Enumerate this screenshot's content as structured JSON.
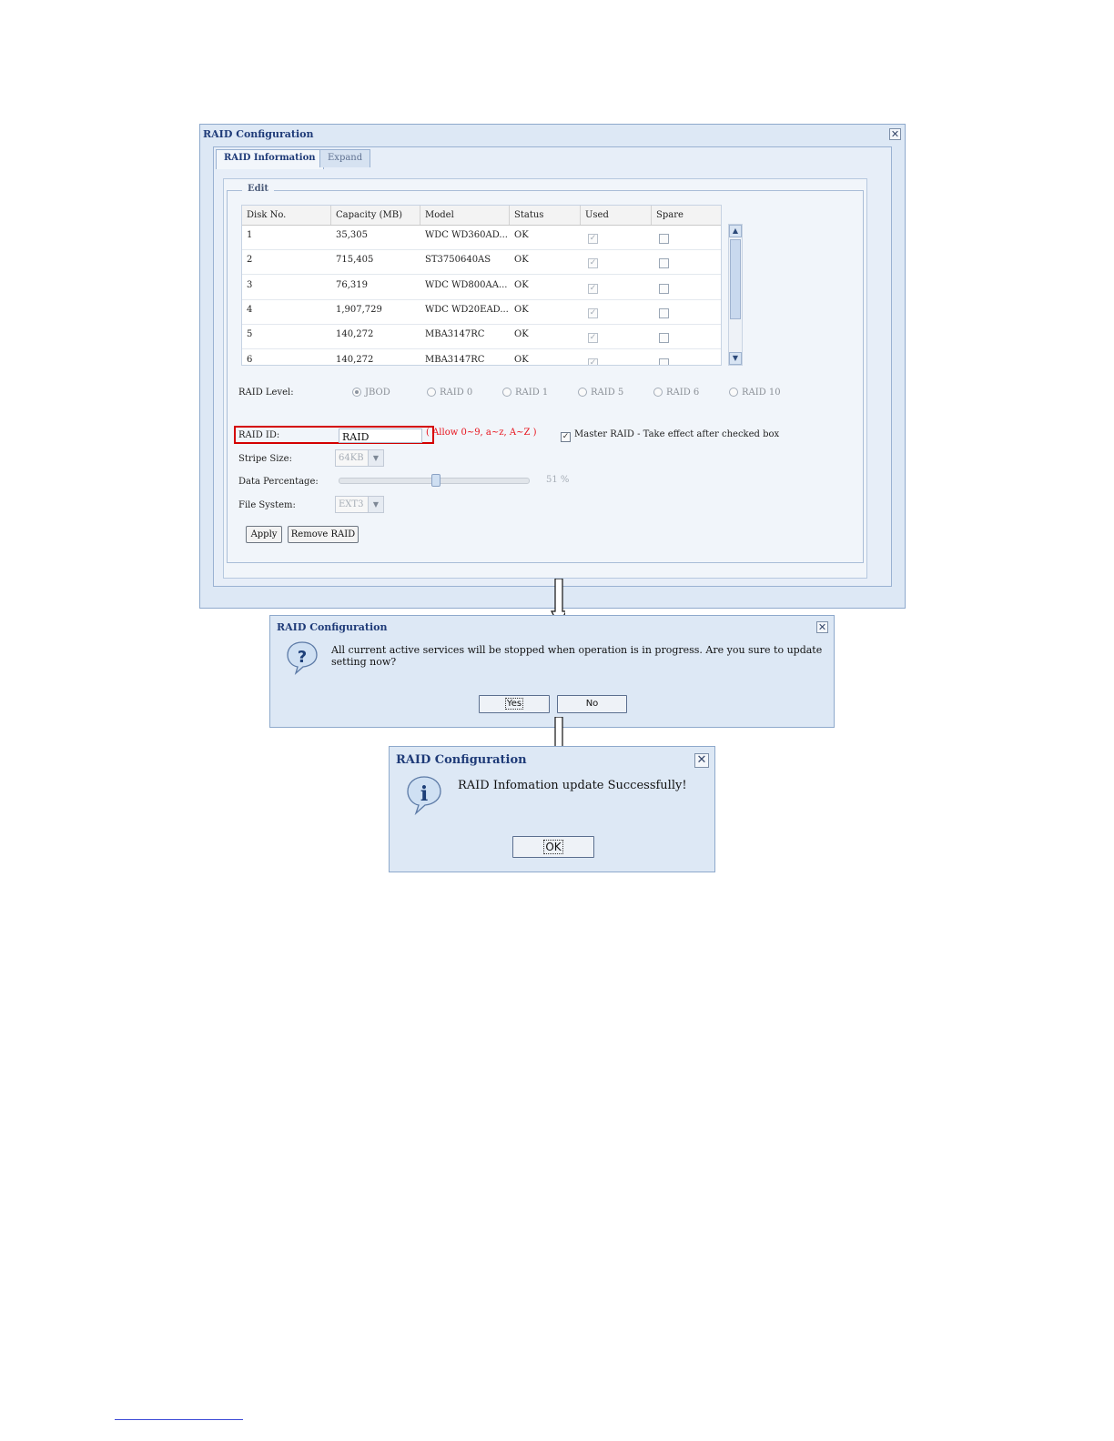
{
  "main_window": {
    "title": "RAID Configuration",
    "close_glyph": "✕",
    "tabs": [
      {
        "label": "RAID Information",
        "active": true
      },
      {
        "label": "Expand",
        "active": false
      }
    ],
    "edit_legend": "Edit",
    "grid": {
      "headers": [
        "Disk No.",
        "Capacity (MB)",
        "Model",
        "Status",
        "Used",
        "Spare"
      ],
      "rows": [
        {
          "disk": "1",
          "capacity": "35,305",
          "model": "WDC WD360AD...",
          "status": "OK",
          "used": true,
          "spare": false
        },
        {
          "disk": "2",
          "capacity": "715,405",
          "model": "ST3750640AS",
          "status": "OK",
          "used": true,
          "spare": false
        },
        {
          "disk": "3",
          "capacity": "76,319",
          "model": "WDC WD800AA...",
          "status": "OK",
          "used": true,
          "spare": false
        },
        {
          "disk": "4",
          "capacity": "1,907,729",
          "model": "WDC WD20EAD...",
          "status": "OK",
          "used": true,
          "spare": false
        },
        {
          "disk": "5",
          "capacity": "140,272",
          "model": "MBA3147RC",
          "status": "OK",
          "used": true,
          "spare": false
        },
        {
          "disk": "6",
          "capacity": "140,272",
          "model": "MBA3147RC",
          "status": "OK",
          "used": true,
          "spare": false
        }
      ]
    },
    "raid_level_label": "RAID Level:",
    "raid_levels": [
      "JBOD",
      "RAID 0",
      "RAID 1",
      "RAID 5",
      "RAID 6",
      "RAID 10"
    ],
    "raid_level_selected": "JBOD",
    "raid_id_label": "RAID ID:",
    "raid_id_value": "RAID",
    "raid_id_hint": "( Allow 0~9, a~z, A~Z )",
    "master_raid_label": "Master RAID - Take effect after checked box",
    "master_raid_checked": true,
    "stripe_size_label": "Stripe Size:",
    "stripe_size_value": "64KB",
    "data_percentage_label": "Data Percentage:",
    "data_percentage_text": "51 %",
    "data_percentage_value": 51,
    "file_system_label": "File System:",
    "file_system_value": "EXT3",
    "apply_label": "Apply",
    "remove_label": "Remove RAID"
  },
  "confirm_dialog": {
    "title": "RAID Configuration",
    "icon": "question-icon",
    "message": "All current active services will be stopped when operation is in progress. Are you sure to update setting now?",
    "yes_label": "Yes",
    "no_label": "No"
  },
  "success_dialog": {
    "title": "RAID Configuration",
    "icon": "info-icon",
    "message": "RAID Infomation update Successfully!",
    "ok_label": "OK"
  },
  "colors": {
    "title_text": "#1f3b78",
    "highlight_box": "#d40000",
    "hint_text": "#e8111b",
    "window_bg": "#dde8f5"
  }
}
